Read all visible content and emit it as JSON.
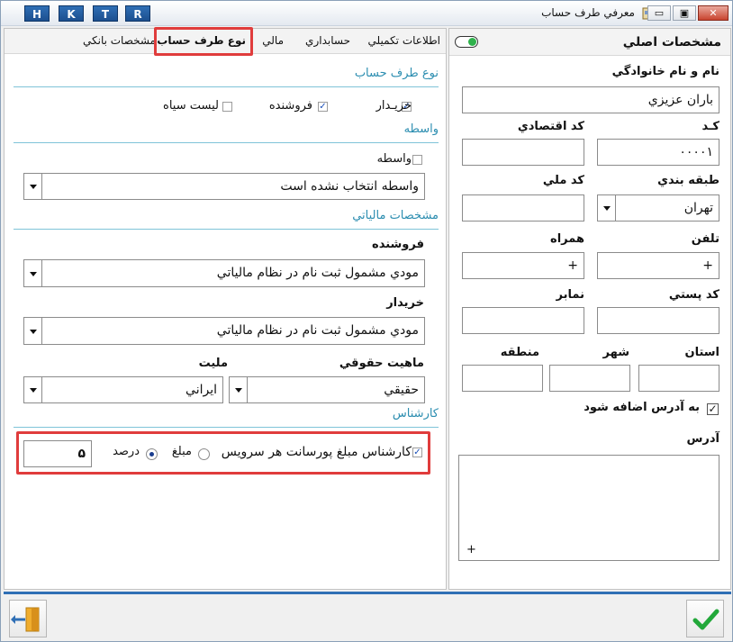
{
  "window": {
    "title": "معرفي طرف حساب",
    "shortcut_buttons": [
      "H",
      "K",
      "T",
      "R"
    ],
    "controls": {
      "minimize": "▭",
      "restore": "▣",
      "close": "✕"
    }
  },
  "right_panel": {
    "header": "مشخصات اصلي",
    "name_label": "نام و نام خانوادگي",
    "name_value": "باران عزيزي",
    "code_label": "کـد",
    "code_value": "٠٠٠٠١",
    "econ_code_label": "کد اقتصادي",
    "econ_code_value": "",
    "category_label": "طبقه بندي",
    "category_value": "تهران",
    "national_code_label": "کد ملي",
    "national_code_value": "",
    "phone_label": "تلفن",
    "phone_value": "+",
    "mobile_label": "همراه",
    "mobile_value": "+",
    "postal_code_label": "کد پستي",
    "postal_code_value": "",
    "fax_label": "نمابر",
    "fax_value": "",
    "province_label": "استان",
    "province_value": "",
    "city_label": "شهر",
    "city_value": "",
    "region_label": "منطقه",
    "region_value": "",
    "add_to_address_label": "به آدرس اضافه شود",
    "add_to_address_checked": true,
    "address_label": "آدرس",
    "address_value": "+"
  },
  "tabs": [
    {
      "label": "اطلاعات تکميلي",
      "active": false
    },
    {
      "label": "حسابداري",
      "active": false
    },
    {
      "label": "مالي",
      "active": false
    },
    {
      "label": "نوع طرف حساب",
      "active": true
    },
    {
      "label": "مشخصات بانکي",
      "active": false
    }
  ],
  "account_type": {
    "section_title": "نوع طرف حساب",
    "buyer_label": "خريـدار",
    "buyer_checked": true,
    "seller_label": "فروشنده",
    "seller_checked": true,
    "blacklist_label": "ليست سياه",
    "blacklist_checked": false
  },
  "intermediary": {
    "section_title": "واسطه",
    "checkbox_label": "واسطه",
    "checked": false,
    "select_value": "واسطه انتخاب نشده است"
  },
  "tax": {
    "section_title": "مشخصات مالياتي",
    "seller_label": "فروشنده",
    "seller_value": "مودي مشمول ثبت نام در نظام مالياتي",
    "buyer_label": "خريدار",
    "buyer_value": "مودي مشمول ثبت نام در نظام مالياتي",
    "legal_nature_label": "ماهيت حقوقي",
    "legal_nature_value": "حقيقي",
    "nationality_label": "مليت",
    "nationality_value": "ايراني"
  },
  "expert": {
    "section_title": "کارشناس",
    "commission_label": "کارشناس مبلغ پورسانت هر سرويس",
    "commission_checked": true,
    "amount_label": "مبلغ",
    "percent_label": "درصد",
    "selected": "percent",
    "value": "۵"
  },
  "footer": {
    "exit_icon": "exit-door-icon",
    "confirm_icon": "checkmark-icon"
  },
  "colors": {
    "section": "#2b8db0",
    "highlight": "#e03c3c",
    "accent": "#2f6fb5",
    "confirm": "#22a83a"
  }
}
